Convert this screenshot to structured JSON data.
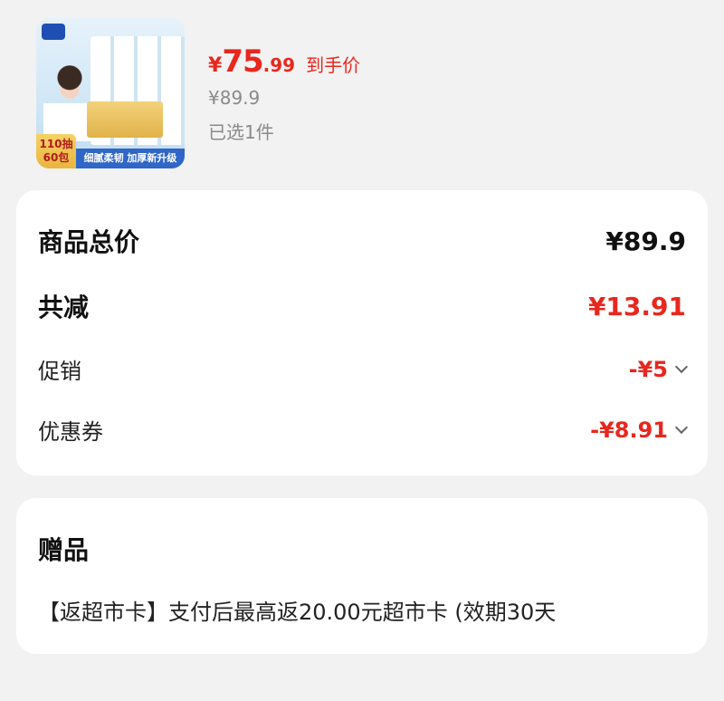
{
  "product": {
    "thumbnail_badge": "110抽\n60包",
    "thumbnail_banner": "细腻柔韧 加厚新升级",
    "currency": "¥",
    "final_price_int": "75",
    "final_price_dec": ".99",
    "final_price_tag": "到手价",
    "original_price": "¥89.9",
    "selected_count": "已选1件"
  },
  "summary": {
    "total_label": "商品总价",
    "total_value": "¥89.9",
    "reduction_label": "共减",
    "reduction_value": "¥13.91",
    "promo_label": "促销",
    "promo_value": "-¥5",
    "coupon_label": "优惠券",
    "coupon_value": "-¥8.91"
  },
  "gift": {
    "title": "赠品",
    "description": "【返超市卡】支付后最高返20.00元超市卡 (效期30天"
  },
  "colors": {
    "accent_red": "#e8271f",
    "background": "#f2f2f2",
    "card": "#ffffff"
  }
}
